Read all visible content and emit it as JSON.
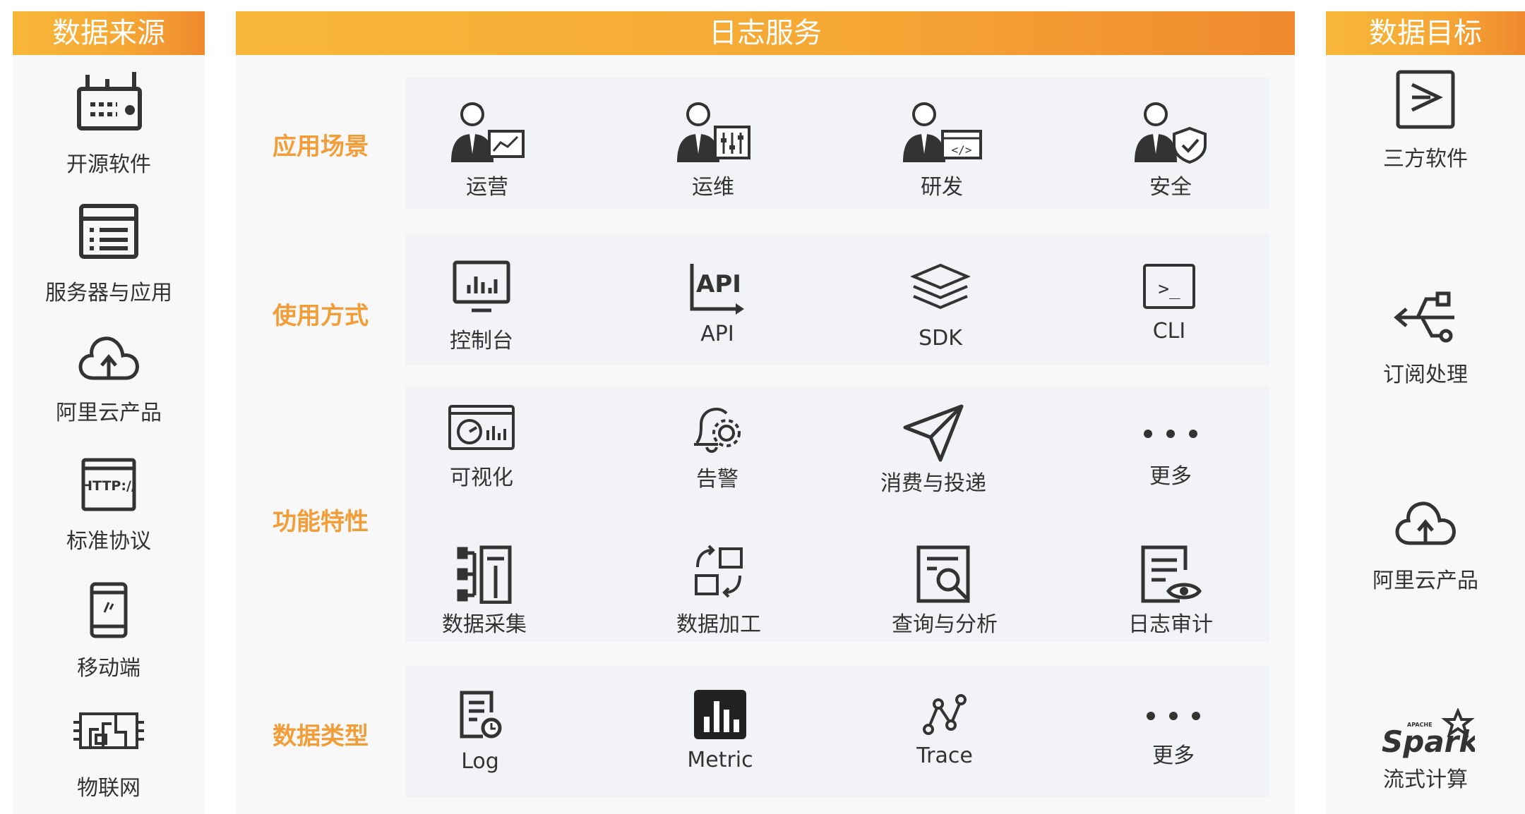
{
  "sources": {
    "header": "数据来源",
    "items": [
      {
        "label": "开源软件",
        "icon": "router-device-icon"
      },
      {
        "label": "服务器与应用",
        "icon": "server-rack-icon"
      },
      {
        "label": "阿里云产品",
        "icon": "cloud-upload-icon"
      },
      {
        "label": "标准协议",
        "icon": "http-browser-icon"
      },
      {
        "label": "移动端",
        "icon": "mobile-phone-icon"
      },
      {
        "label": "物联网",
        "icon": "circuit-board-icon"
      }
    ]
  },
  "service": {
    "header": "日志服务",
    "rows": [
      {
        "title": "应用场景",
        "items": [
          {
            "label": "运营",
            "icon": "person-chart-icon"
          },
          {
            "label": "运维",
            "icon": "person-sliders-icon"
          },
          {
            "label": "研发",
            "icon": "person-code-icon"
          },
          {
            "label": "安全",
            "icon": "person-shield-icon"
          }
        ]
      },
      {
        "title": "使用方式",
        "items": [
          {
            "label": "控制台",
            "icon": "monitor-chart-icon"
          },
          {
            "label": "API",
            "icon": "api-icon",
            "badge": "API"
          },
          {
            "label": "SDK",
            "icon": "layers-stack-icon"
          },
          {
            "label": "CLI",
            "icon": "terminal-icon",
            "prompt": ">_"
          }
        ]
      },
      {
        "title": "功能特性",
        "items": [
          {
            "label": "可视化",
            "icon": "dashboard-icon"
          },
          {
            "label": "告警",
            "icon": "bell-gear-icon"
          },
          {
            "label": "消费与投递",
            "icon": "paper-plane-icon"
          },
          {
            "label": "更多",
            "icon": "more-dots-icon"
          },
          {
            "label": "数据采集",
            "icon": "data-collect-icon"
          },
          {
            "label": "数据加工",
            "icon": "data-transform-icon"
          },
          {
            "label": "查询与分析",
            "icon": "search-document-icon"
          },
          {
            "label": "日志审计",
            "icon": "audit-document-icon"
          }
        ]
      },
      {
        "title": "数据类型",
        "items": [
          {
            "label": "Log",
            "icon": "log-document-icon"
          },
          {
            "label": "Metric",
            "icon": "metric-bars-icon"
          },
          {
            "label": "Trace",
            "icon": "trace-nodes-icon"
          },
          {
            "label": "更多",
            "icon": "more-dots-icon"
          }
        ]
      }
    ]
  },
  "targets": {
    "header": "数据目标",
    "items": [
      {
        "label": "三方软件",
        "icon": "forward-arrow-icon"
      },
      {
        "label": "订阅处理",
        "icon": "usb-branch-icon"
      },
      {
        "label": "阿里云产品",
        "icon": "cloud-upload-icon"
      },
      {
        "label": "流式计算",
        "icon": "spark-logo-icon",
        "logo_small": "APACHE",
        "logo_text": "Spark"
      }
    ]
  },
  "colors": {
    "header_gradient_start": "#f7b73a",
    "header_gradient_end": "#f08a2f",
    "row_title": "#f29d38",
    "row_background": "#f2f3f7",
    "icon_dark": "#333333"
  }
}
